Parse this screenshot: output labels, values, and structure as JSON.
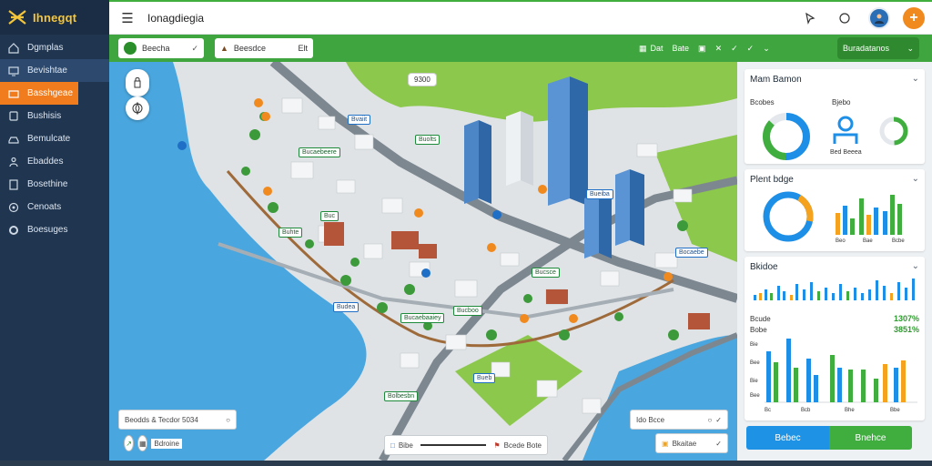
{
  "brand": {
    "name": "Ihnegqt",
    "accent": "#f3c53a"
  },
  "sidebar": {
    "items": [
      {
        "label": "Dgmplas",
        "icon": "home-icon"
      },
      {
        "label": "Bevishtae",
        "icon": "monitor-icon"
      },
      {
        "label": "Basshgeae",
        "icon": "briefcase-icon"
      },
      {
        "label": "Bushisis",
        "icon": "bus-icon"
      },
      {
        "label": "Bemulcate",
        "icon": "car-icon"
      },
      {
        "label": "Ebaddes",
        "icon": "person-icon"
      },
      {
        "label": "Bosethine",
        "icon": "layers-icon"
      },
      {
        "label": "Cenoats",
        "icon": "target-icon"
      },
      {
        "label": "Boesuges",
        "icon": "settings-icon"
      }
    ]
  },
  "header": {
    "title": "Ionagdiegia"
  },
  "toolbar": {
    "search_label": "Beecha",
    "filter_label": "Beesdce",
    "filter_count": "Elt",
    "tools": [
      "Dat",
      "Bate"
    ],
    "panel_dropdown": "Buradatanos"
  },
  "map": {
    "price_tag": "9300",
    "labels": [
      "Bvaiit",
      "Bucaebeere",
      "Buolts",
      "Buc",
      "Bueiba",
      "Bucsce",
      "Budea",
      "Bucaebaaiey",
      "Bucboo",
      "Bocaebe",
      "Bueb",
      "Buhte",
      "Bolbesbn"
    ],
    "bottom_left_input": "Beodds & Tecdor 5034",
    "bottom_left_sub": "Bdroine",
    "bottom_center": "Bibe",
    "bottom_center_right": "Bcede Bote",
    "bottom_right_input": "Ido Bcce",
    "bottom_right_btn": "Bkaitae"
  },
  "panel": {
    "card1": {
      "title": "Mam Bamon",
      "col1": "Bcobes",
      "col2": "Bjebo",
      "sub": "Bed Beeea"
    },
    "card2": {
      "title": "Plent bdge",
      "ticks": [
        "Beo",
        "Bae",
        "Bcbe"
      ]
    },
    "card3": {
      "title": "Bkidoe",
      "stat1_label": "Bcude",
      "stat1_value": "1307%",
      "stat2_label": "Bobe",
      "stat2_value": "3851%",
      "y_ticks": [
        "Bie",
        "Bee",
        "Bie",
        "Bee"
      ],
      "x_ticks": [
        "Bc",
        "Bcb",
        "Bhe",
        "Bbe"
      ]
    },
    "split_left": "Bebec",
    "split_right": "Bnehce"
  },
  "colors": {
    "sidebar_bg": "#1f3550",
    "active_orange": "#f07c1e",
    "toolbar_green": "#3fa53f",
    "water": "#4aa6de",
    "park": "#8cc84b",
    "chart_blue": "#1e8fe6",
    "chart_green": "#3fae3f",
    "chart_orange": "#f5a21e"
  }
}
